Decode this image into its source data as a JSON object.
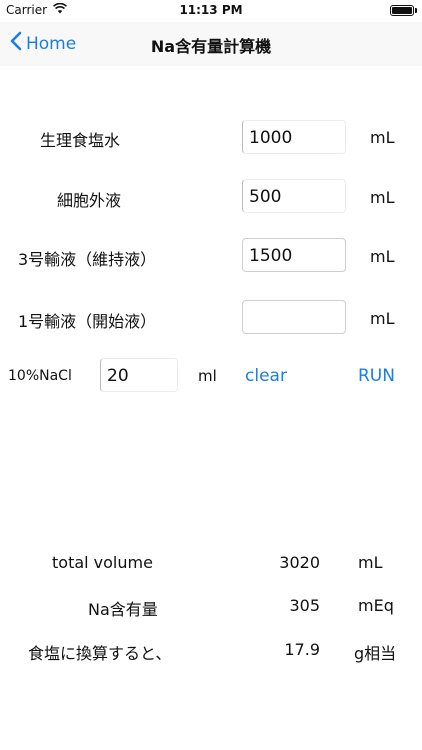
{
  "status_bar": {
    "carrier": "Carrier",
    "wifi_icon": "wifi-icon",
    "time": "11:13 PM",
    "battery_icon": "battery-icon"
  },
  "nav": {
    "back_label": "Home",
    "title": "Na含有量計算機"
  },
  "inputs": {
    "saline": {
      "label": "生理食塩水",
      "value": "1000",
      "unit": "mL"
    },
    "ecf": {
      "label": "細胞外液",
      "value": "500",
      "unit": "mL"
    },
    "no3": {
      "label": "3号輸液（維持液）",
      "value": "1500",
      "unit": "mL"
    },
    "no1": {
      "label": "1号輸液（開始液）",
      "value": "",
      "unit": "mL"
    }
  },
  "nacl": {
    "label": "10%NaCl",
    "value": "20",
    "unit": "ml",
    "clear_label": "clear",
    "run_label": "RUN"
  },
  "results": {
    "total_volume": {
      "label": "total volume",
      "value": "3020",
      "unit": "mL"
    },
    "na_content": {
      "label": "Na含有量",
      "value": "305",
      "unit": "mEq"
    },
    "salt_equiv": {
      "label": "食塩に換算すると、",
      "value": "17.9",
      "unit": "g相当"
    }
  },
  "colors": {
    "accent": "#1a7ee6",
    "nav_background": "#f8f8f8"
  }
}
